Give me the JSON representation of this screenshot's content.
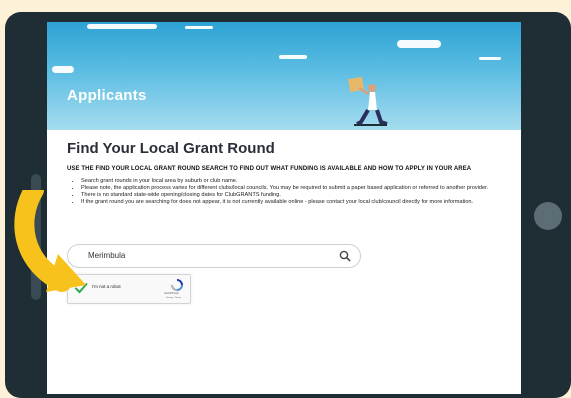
{
  "hero": {
    "title": "Applicants"
  },
  "section": {
    "title": "Find Your Local Grant Round",
    "subtitle": "USE THE FIND YOUR LOCAL GRANT ROUND SEARCH TO FIND OUT WHAT FUNDING IS AVAILABLE AND HOW TO APPLY IN YOUR AREA",
    "bullets": [
      "Search grant rounds in your local area by suburb or club name.",
      "Please note, the application process varies for different clubs/local councils. You may be required to submit a paper based application or referred to another provider.",
      "There is no standard state-wide opening/closing dates for ClubGRANTS funding.",
      "If the grant round you are searching for does not appear, it is not currently available online - please contact your local club/council directly for more information."
    ]
  },
  "search": {
    "value": "Merimbula",
    "icon": "search-icon"
  },
  "recaptcha": {
    "label": "I'm not a robot",
    "brand": "reCAPTCHA",
    "terms": "Privacy - Terms",
    "icon": "check-icon"
  },
  "colors": {
    "page_bg": "#fdf2d8",
    "tablet": "#1f2d34",
    "sky_top": "#2ea2d4",
    "arrow": "#f7c21b",
    "check": "#2fa84f"
  }
}
